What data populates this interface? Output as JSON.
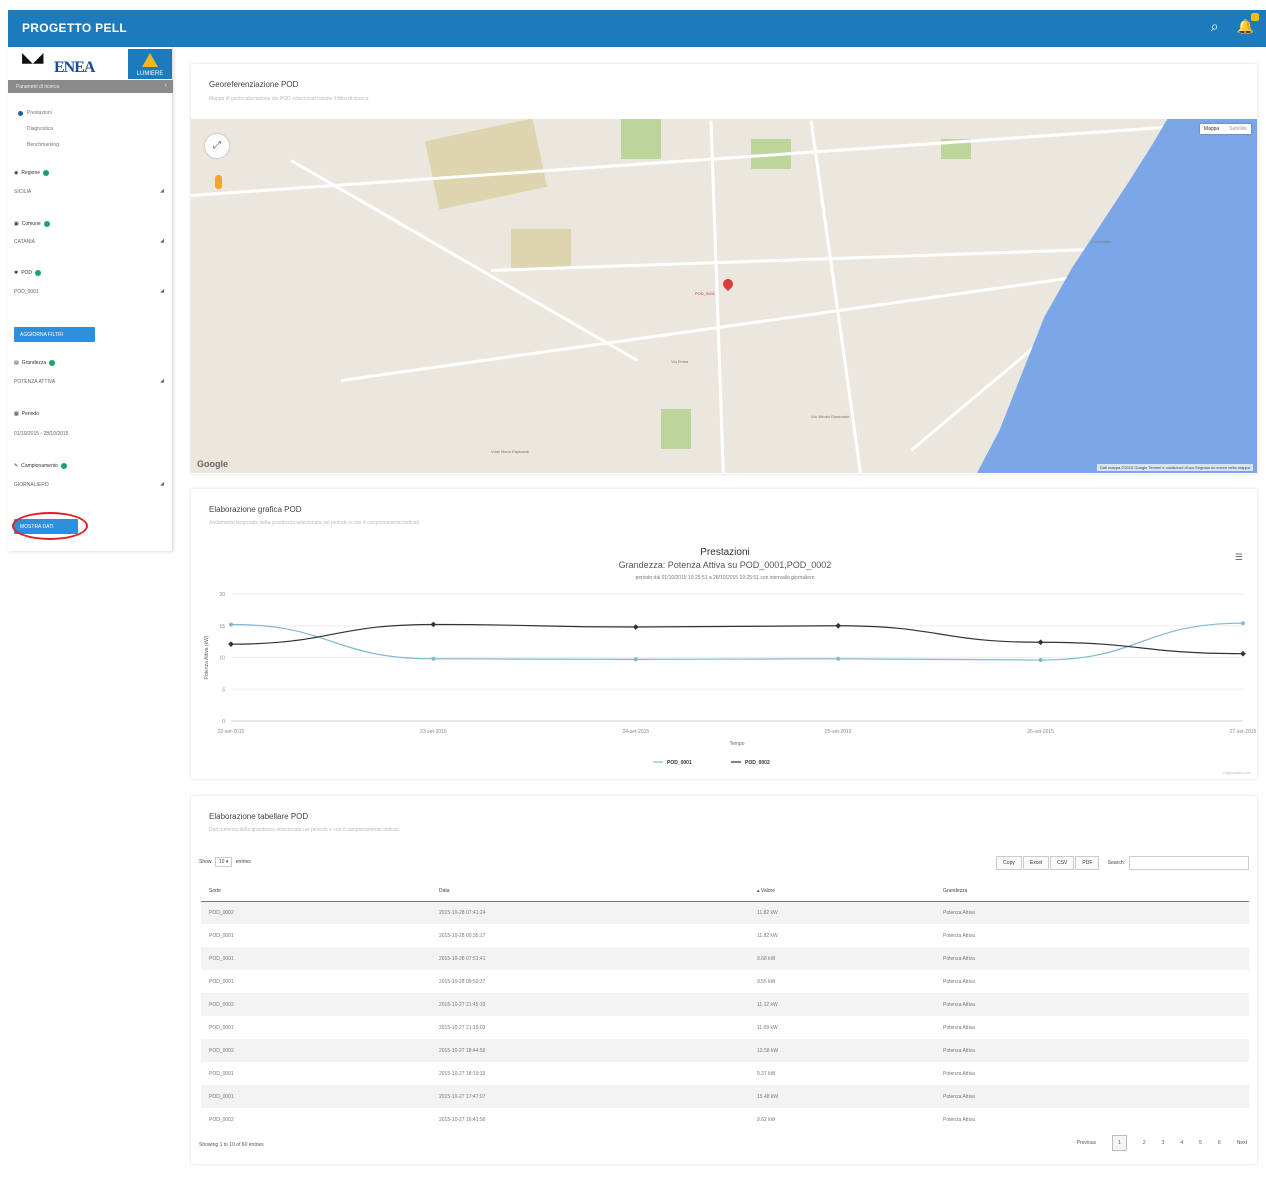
{
  "app": {
    "title": "PROGETTO PELL",
    "logo": {
      "main": "ENEA",
      "sub": "LUMIERE"
    }
  },
  "topbar": {
    "icons": [
      "search-icon",
      "bell-icon"
    ]
  },
  "colors": {
    "primary": "#1b7bbd",
    "button": "#2e8fdd",
    "ok": "#1aa463",
    "series1": "#7fb9d4",
    "series2": "#333333",
    "highlight_ring": "#e02020"
  },
  "sidebar": {
    "header": "Parametri di ricerca",
    "radios": [
      {
        "label": "Prestazioni",
        "selected": true
      },
      {
        "label": "Diagnostica",
        "selected": false
      },
      {
        "label": "Benchmarking",
        "selected": false
      }
    ],
    "filters": [
      {
        "label": "Regione",
        "value": "SICILIA"
      },
      {
        "label": "Comune",
        "value": "CATANIA"
      },
      {
        "label": "POD",
        "value": "POD_0001"
      }
    ],
    "update_button": "AGGIORNA FILTRI",
    "filters2": [
      {
        "label": "Grandezza",
        "value": "POTENZA ATTIVA"
      },
      {
        "label": "Periodo",
        "value": "01/10/2015 - 28/10/2015"
      },
      {
        "label": "Campionamento",
        "value": "GIORNALIERO"
      }
    ],
    "show_button": "MOSTRA DATI"
  },
  "map_card": {
    "title": "Georeferenziazione POD",
    "subtitle": "Mappa di geolocalizzazione dei POD selezionati tramite il filtro di ricerca",
    "map_type": {
      "map": "Mappa",
      "satellite": "Satellite"
    },
    "marker_label": "POD_0001",
    "places": [
      "Via Etnea",
      "Corso Italia",
      "Viale Mario Rapisardi",
      "Via Vittorio Emanuele"
    ],
    "google": "Google",
    "footer": "Dati mappa ©2015 Google   Termini e condizioni d'uso   Segnala un errore nella mappa"
  },
  "chart_card": {
    "title": "Elaborazione grafica POD",
    "subtitle": "Andamento temporale della grandezza selezionata nel periodo e con il campionamento indicati",
    "credits": "Highcharts.com"
  },
  "chart_data": {
    "type": "line",
    "title": "Prestazioni",
    "subtitle": "Grandezza: Potenza Attiva su POD_0001,POD_0002",
    "subtitle2": "periodo dal 01/10/2015 19:25:51 a 28/10/2015 19:25:51 con intervallo giornaliero",
    "xlabel": "Tempo",
    "ylabel": "Potenza Attiva (kW)",
    "ylim": [
      0,
      20
    ],
    "yticks": [
      0,
      5,
      10,
      15,
      20
    ],
    "x": [
      "22-set-2015",
      "23-set-2015",
      "24-set-2015",
      "25-set-2015",
      "26-set-2015",
      "27-set-2015"
    ],
    "series": [
      {
        "name": "POD_0001",
        "values": [
          15.2,
          9.8,
          9.7,
          9.8,
          9.6,
          15.4
        ]
      },
      {
        "name": "POD_0002",
        "values": [
          12.1,
          15.2,
          14.8,
          15.0,
          12.4,
          10.6
        ]
      }
    ],
    "legend": "bottom-center",
    "grid": true
  },
  "table_card": {
    "title": "Elaborazione tabellare POD",
    "subtitle": "Dati numerici della grandezza selezionata nel periodo e con il campionamento indicati",
    "show_label": "Show",
    "show_value": "10",
    "entries_label": "entries",
    "buttons": [
      "Copy",
      "Excel",
      "CSV",
      "PDF"
    ],
    "search_label": "Search:",
    "columns": [
      "Sorte",
      "Data",
      "Valore",
      "Grandezza"
    ],
    "rows": [
      [
        "POD_0002",
        "2015-10-28 07:41:24",
        "11.82 kW",
        "Potenza Attiva"
      ],
      [
        "POD_0001",
        "2015-10-28 00:35:17",
        "11.82 kW",
        "Potenza Attiva"
      ],
      [
        "POD_0001",
        "2015-10-28 07:51:41",
        "9.68 kW",
        "Potenza Attiva"
      ],
      [
        "POD_0001",
        "2015-10-28 09:50:37",
        "9.55 kW",
        "Potenza Attiva"
      ],
      [
        "POD_0002",
        "2015-10-27 21:45:33",
        "11.12 kW",
        "Potenza Attiva"
      ],
      [
        "POD_0001",
        "2015-10-27 21:15:03",
        "11.09 kW",
        "Potenza Attiva"
      ],
      [
        "POD_0002",
        "2015-10-27 18:44:56",
        "13.58 kW",
        "Potenza Attiva"
      ],
      [
        "POD_0001",
        "2015-10-27 18:19:33",
        "9.37 kW",
        "Potenza Attiva"
      ],
      [
        "POD_0001",
        "2015-10-27 17:47:07",
        "15.48 kW",
        "Potenza Attiva"
      ],
      [
        "POD_0002",
        "2015-10-27 16:41:56",
        "9.62 kW",
        "Potenza Attiva"
      ]
    ],
    "info": "Showing 1 to 10 of 60 entries",
    "pager": {
      "previous": "Previous",
      "pages": [
        "1",
        "2",
        "3",
        "4",
        "5",
        "6"
      ],
      "next": "Next"
    }
  }
}
